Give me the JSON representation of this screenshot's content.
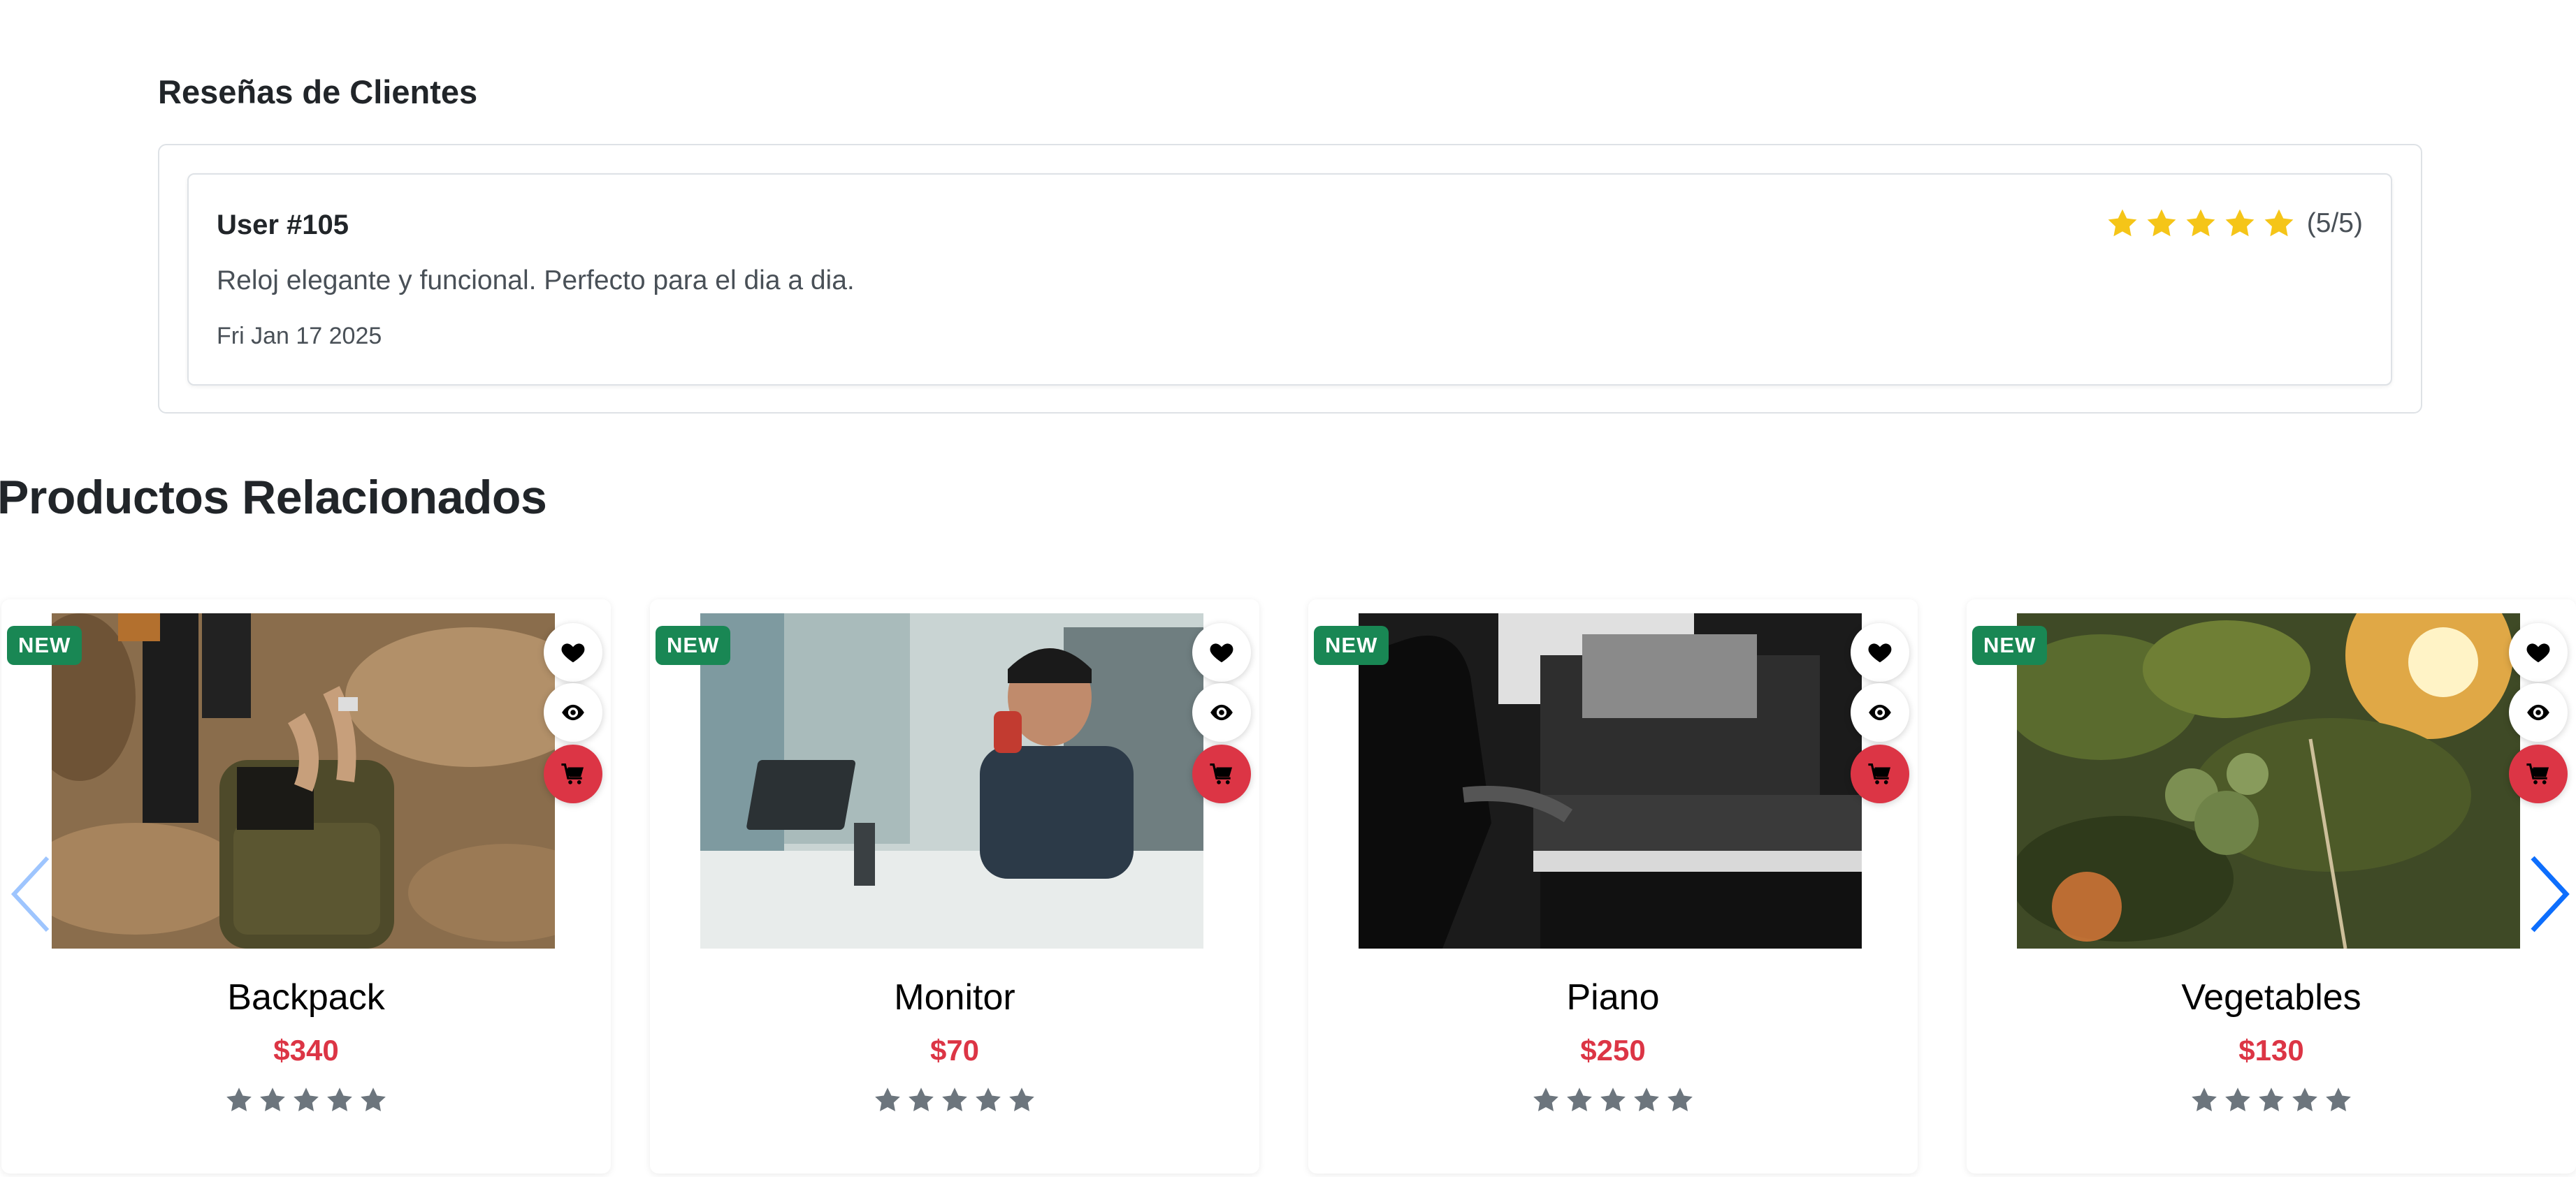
{
  "reviews": {
    "title": "Reseñas de Clientes",
    "items": [
      {
        "user": "User #105",
        "text": "Reloj elegante y funcional. Perfecto para el dia a dia.",
        "date": "Fri Jan 17 2025",
        "rating": 5,
        "rating_text": "(5/5)"
      }
    ],
    "star_color": "#f5c518"
  },
  "related": {
    "title": "Productos Relacionados",
    "products": [
      {
        "name": "Backpack",
        "price": "$340",
        "badge": "NEW",
        "rating": 5,
        "image": "backpack-photo"
      },
      {
        "name": "Monitor",
        "price": "$70",
        "badge": "NEW",
        "rating": 5,
        "image": "monitor-photo"
      },
      {
        "name": "Piano",
        "price": "$250",
        "badge": "NEW",
        "rating": 5,
        "image": "piano-photo"
      },
      {
        "name": "Vegetables",
        "price": "$130",
        "badge": "NEW",
        "rating": 5,
        "image": "vegetables-photo"
      }
    ],
    "icons": {
      "wishlist": "heart-icon",
      "view": "eye-icon",
      "cart": "cart-icon"
    }
  },
  "carousel": {
    "prev_icon": "chevron-left-icon",
    "next_icon": "chevron-right-icon"
  },
  "colors": {
    "accent_red": "#dc3545",
    "badge_green": "#198754",
    "carousel_blue": "#0d6efd",
    "star_gray": "#6c757d"
  }
}
